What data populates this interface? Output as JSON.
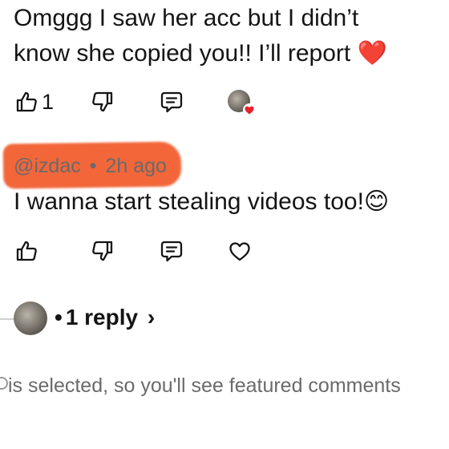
{
  "comment_1": {
    "text_line1": "Omggg I saw her acc but I didn’t",
    "text_line2": "know she copied you!! I’ll report",
    "emoji": "❤️",
    "like_count": "1"
  },
  "comment_2": {
    "username": "@izdac",
    "separator": "•",
    "timestamp": "2h ago",
    "text": "I wanna start stealing videos too!",
    "emoji": "😊"
  },
  "replies": {
    "label": "1 reply",
    "bullet": "•",
    "chevron": "›"
  },
  "footer": {
    "note": "is selected, so you'll see featured comments"
  },
  "colors": {
    "highlight": "#f15a2a",
    "heart_badge": "#e8212d"
  },
  "icons": [
    "thumbs-up-icon",
    "thumbs-down-icon",
    "comment-icon",
    "heart-icon",
    "avatar",
    "chevron-right-icon"
  ]
}
